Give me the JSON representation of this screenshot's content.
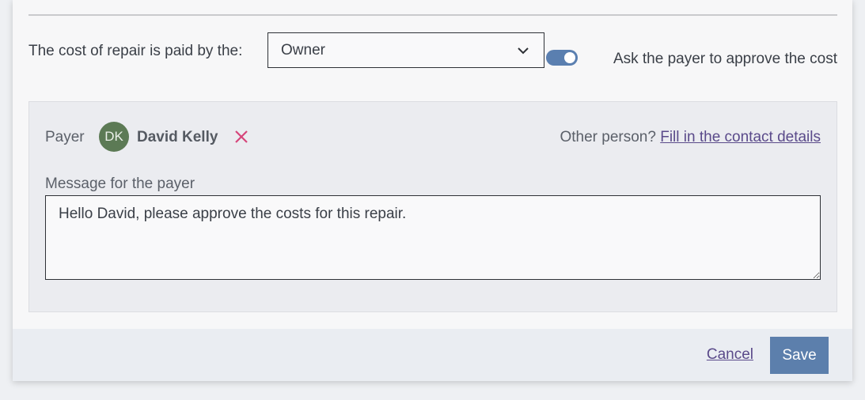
{
  "cost": {
    "label": "The cost of repair is paid by the:",
    "payer_select": {
      "selected": "Owner"
    },
    "approve_toggle": {
      "on": true,
      "label": "Ask the payer to approve the cost"
    }
  },
  "payer_panel": {
    "label": "Payer",
    "avatar_initials": "DK",
    "name": "David Kelly",
    "other_person_text": "Other person?",
    "fill_contact_link": "Fill in the contact details",
    "message_label": "Message for the payer",
    "message_value": "Hello David, please approve the costs for this repair."
  },
  "footer": {
    "cancel_label": "Cancel",
    "save_label": "Save"
  },
  "colors": {
    "accent": "#5c7fac",
    "link": "#5a4a8a",
    "remove": "#d6457a",
    "avatar_bg": "#5c7a55"
  },
  "icons": {
    "select_chevron": "chevron-down-icon",
    "remove_payer": "close-icon"
  }
}
